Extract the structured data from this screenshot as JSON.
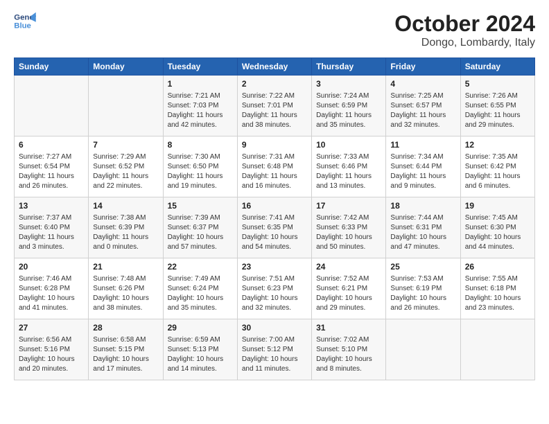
{
  "header": {
    "logo_line1": "General",
    "logo_line2": "Blue",
    "month_year": "October 2024",
    "location": "Dongo, Lombardy, Italy"
  },
  "days_of_week": [
    "Sunday",
    "Monday",
    "Tuesday",
    "Wednesday",
    "Thursday",
    "Friday",
    "Saturday"
  ],
  "weeks": [
    [
      {
        "num": "",
        "info": ""
      },
      {
        "num": "",
        "info": ""
      },
      {
        "num": "1",
        "info": "Sunrise: 7:21 AM\nSunset: 7:03 PM\nDaylight: 11 hours\nand 42 minutes."
      },
      {
        "num": "2",
        "info": "Sunrise: 7:22 AM\nSunset: 7:01 PM\nDaylight: 11 hours\nand 38 minutes."
      },
      {
        "num": "3",
        "info": "Sunrise: 7:24 AM\nSunset: 6:59 PM\nDaylight: 11 hours\nand 35 minutes."
      },
      {
        "num": "4",
        "info": "Sunrise: 7:25 AM\nSunset: 6:57 PM\nDaylight: 11 hours\nand 32 minutes."
      },
      {
        "num": "5",
        "info": "Sunrise: 7:26 AM\nSunset: 6:55 PM\nDaylight: 11 hours\nand 29 minutes."
      }
    ],
    [
      {
        "num": "6",
        "info": "Sunrise: 7:27 AM\nSunset: 6:54 PM\nDaylight: 11 hours\nand 26 minutes."
      },
      {
        "num": "7",
        "info": "Sunrise: 7:29 AM\nSunset: 6:52 PM\nDaylight: 11 hours\nand 22 minutes."
      },
      {
        "num": "8",
        "info": "Sunrise: 7:30 AM\nSunset: 6:50 PM\nDaylight: 11 hours\nand 19 minutes."
      },
      {
        "num": "9",
        "info": "Sunrise: 7:31 AM\nSunset: 6:48 PM\nDaylight: 11 hours\nand 16 minutes."
      },
      {
        "num": "10",
        "info": "Sunrise: 7:33 AM\nSunset: 6:46 PM\nDaylight: 11 hours\nand 13 minutes."
      },
      {
        "num": "11",
        "info": "Sunrise: 7:34 AM\nSunset: 6:44 PM\nDaylight: 11 hours\nand 9 minutes."
      },
      {
        "num": "12",
        "info": "Sunrise: 7:35 AM\nSunset: 6:42 PM\nDaylight: 11 hours\nand 6 minutes."
      }
    ],
    [
      {
        "num": "13",
        "info": "Sunrise: 7:37 AM\nSunset: 6:40 PM\nDaylight: 11 hours\nand 3 minutes."
      },
      {
        "num": "14",
        "info": "Sunrise: 7:38 AM\nSunset: 6:39 PM\nDaylight: 11 hours\nand 0 minutes."
      },
      {
        "num": "15",
        "info": "Sunrise: 7:39 AM\nSunset: 6:37 PM\nDaylight: 10 hours\nand 57 minutes."
      },
      {
        "num": "16",
        "info": "Sunrise: 7:41 AM\nSunset: 6:35 PM\nDaylight: 10 hours\nand 54 minutes."
      },
      {
        "num": "17",
        "info": "Sunrise: 7:42 AM\nSunset: 6:33 PM\nDaylight: 10 hours\nand 50 minutes."
      },
      {
        "num": "18",
        "info": "Sunrise: 7:44 AM\nSunset: 6:31 PM\nDaylight: 10 hours\nand 47 minutes."
      },
      {
        "num": "19",
        "info": "Sunrise: 7:45 AM\nSunset: 6:30 PM\nDaylight: 10 hours\nand 44 minutes."
      }
    ],
    [
      {
        "num": "20",
        "info": "Sunrise: 7:46 AM\nSunset: 6:28 PM\nDaylight: 10 hours\nand 41 minutes."
      },
      {
        "num": "21",
        "info": "Sunrise: 7:48 AM\nSunset: 6:26 PM\nDaylight: 10 hours\nand 38 minutes."
      },
      {
        "num": "22",
        "info": "Sunrise: 7:49 AM\nSunset: 6:24 PM\nDaylight: 10 hours\nand 35 minutes."
      },
      {
        "num": "23",
        "info": "Sunrise: 7:51 AM\nSunset: 6:23 PM\nDaylight: 10 hours\nand 32 minutes."
      },
      {
        "num": "24",
        "info": "Sunrise: 7:52 AM\nSunset: 6:21 PM\nDaylight: 10 hours\nand 29 minutes."
      },
      {
        "num": "25",
        "info": "Sunrise: 7:53 AM\nSunset: 6:19 PM\nDaylight: 10 hours\nand 26 minutes."
      },
      {
        "num": "26",
        "info": "Sunrise: 7:55 AM\nSunset: 6:18 PM\nDaylight: 10 hours\nand 23 minutes."
      }
    ],
    [
      {
        "num": "27",
        "info": "Sunrise: 6:56 AM\nSunset: 5:16 PM\nDaylight: 10 hours\nand 20 minutes."
      },
      {
        "num": "28",
        "info": "Sunrise: 6:58 AM\nSunset: 5:15 PM\nDaylight: 10 hours\nand 17 minutes."
      },
      {
        "num": "29",
        "info": "Sunrise: 6:59 AM\nSunset: 5:13 PM\nDaylight: 10 hours\nand 14 minutes."
      },
      {
        "num": "30",
        "info": "Sunrise: 7:00 AM\nSunset: 5:12 PM\nDaylight: 10 hours\nand 11 minutes."
      },
      {
        "num": "31",
        "info": "Sunrise: 7:02 AM\nSunset: 5:10 PM\nDaylight: 10 hours\nand 8 minutes."
      },
      {
        "num": "",
        "info": ""
      },
      {
        "num": "",
        "info": ""
      }
    ]
  ]
}
